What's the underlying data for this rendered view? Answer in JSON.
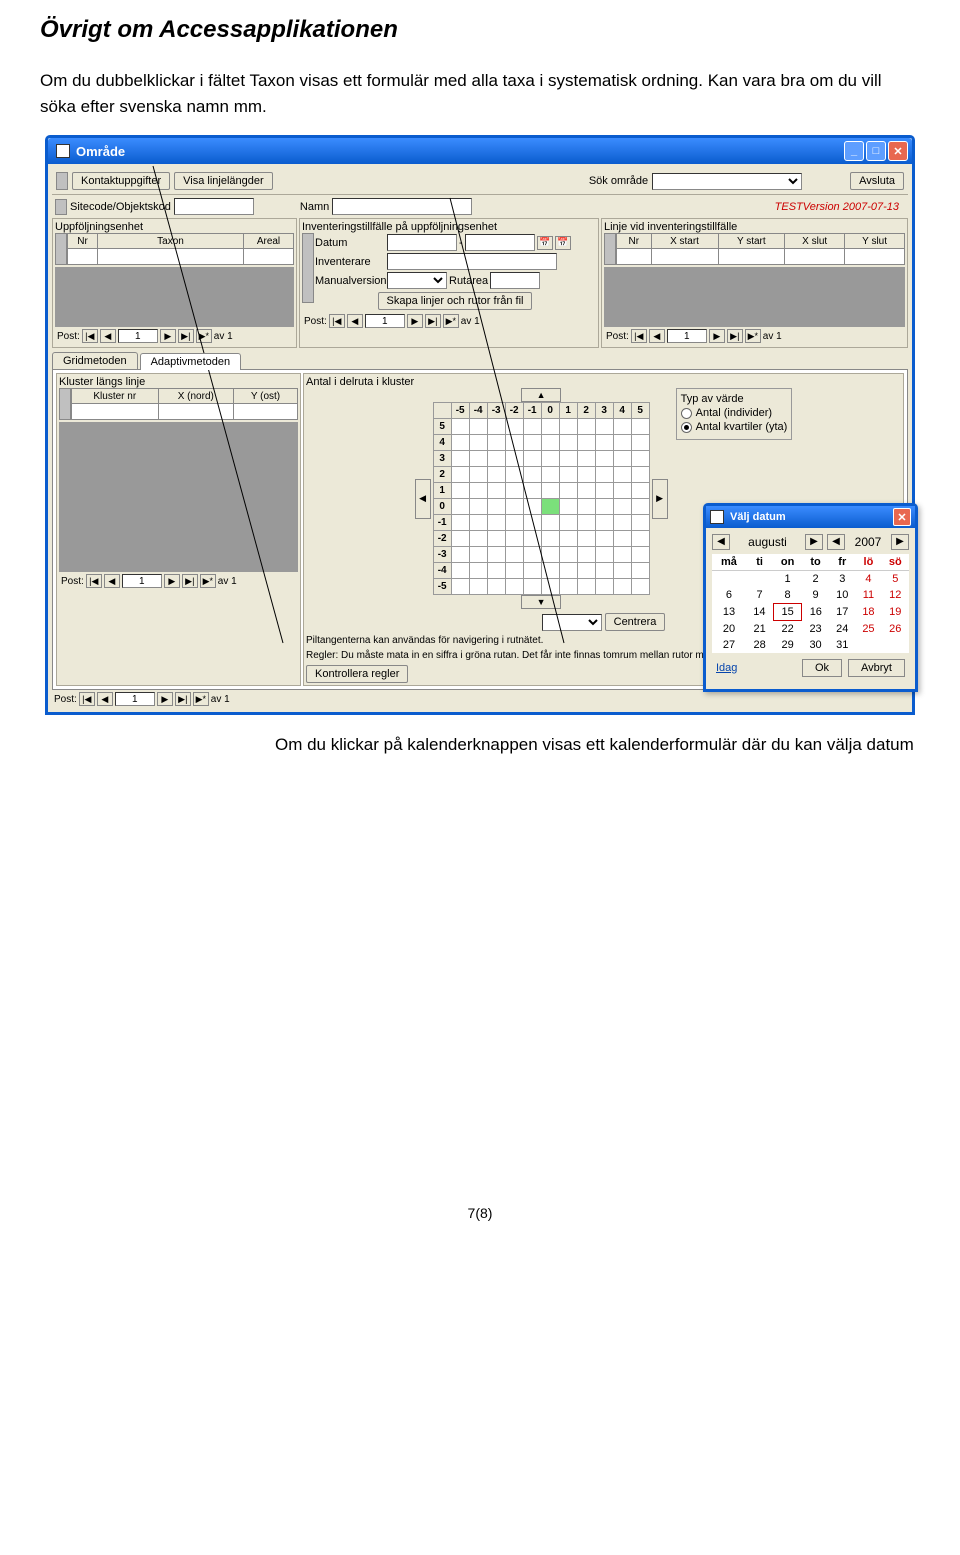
{
  "page": {
    "heading": "Övrigt om Accessapplikationen",
    "desc": "Om du dubbelklickar i fältet Taxon visas ett formulär med alla taxa i systematisk ordning. Kan vara bra om du vill söka efter svenska namn mm.",
    "footer_desc": "Om du klickar på kalenderknappen visas ett kalenderformulär där du kan välja datum",
    "page_num": "7(8)"
  },
  "main_window": {
    "title": "Område",
    "top": {
      "kontakt_btn": "Kontaktuppgifter",
      "visa_btn": "Visa linjelängder",
      "sok_label": "Sök område",
      "avsluta": "Avsluta",
      "version": "TESTVersion 2007-07-13"
    },
    "row2": {
      "sitecode_label": "Sitecode/Objektskod",
      "namn_label": "Namn"
    },
    "uppf": {
      "group": "Uppföljningsenhet",
      "cols": [
        "Nr",
        "Taxon",
        "Areal"
      ],
      "post_label": "Post:",
      "nav_of": "av 1",
      "nav_pos": "1"
    },
    "inv": {
      "group": "Inventeringstillfälle på uppföljningsenhet",
      "datum": "Datum",
      "dash": "-",
      "inventerare": "Inventerare",
      "manualversion": "Manualversion",
      "rutarea": "Rutarea",
      "skapa_btn": "Skapa linjer och rutor från fil",
      "post_label": "Post:",
      "nav_of": "av 1",
      "nav_pos": "1"
    },
    "linje": {
      "group": "Linje vid inventeringstillfälle",
      "cols": [
        "Nr",
        "X start",
        "Y start",
        "X slut",
        "Y slut"
      ],
      "post_label": "Post:",
      "nav_of": "av 1",
      "nav_pos": "1"
    },
    "tabs": {
      "grid": "Gridmetoden",
      "adaptiv": "Adaptivmetoden"
    },
    "kluster": {
      "group": "Kluster längs linje",
      "cols": [
        "Kluster nr",
        "X (nord)",
        "Y (ost)"
      ],
      "post_label": "Post:",
      "nav_of": "av 1",
      "nav_pos": "1"
    },
    "delruta": {
      "group": "Antal i delruta i kluster",
      "x_heads": [
        "-5",
        "-4",
        "-3",
        "-2",
        "-1",
        "0",
        "1",
        "2",
        "3",
        "4",
        "5"
      ],
      "y_heads": [
        "5",
        "4",
        "3",
        "2",
        "1",
        "0",
        "-1",
        "-2",
        "-3",
        "-4",
        "-5"
      ],
      "centrera": "Centrera",
      "help1": "Piltangenterna kan användas för navigering i rutnätet.",
      "help2": "Regler: Du måste mata in en siffra i gröna rutan. Det får inte finnas tomrum mellan rutor med värden.",
      "kontrollera": "Kontrollera regler"
    },
    "typ": {
      "group": "Typ av värde",
      "opt1": "Antal (individer)",
      "opt2": "Antal kvartiler (yta)"
    },
    "bottom_post": {
      "label": "Post:",
      "nav_of": "av 1",
      "nav_pos": "1"
    }
  },
  "datepicker": {
    "title": "Välj datum",
    "month": "augusti",
    "year": "2007",
    "weekdays": [
      "må",
      "ti",
      "on",
      "to",
      "fr",
      "lö",
      "sö"
    ],
    "days": [
      [
        "",
        "",
        "1",
        "2",
        "3",
        "4",
        "5"
      ],
      [
        "6",
        "7",
        "8",
        "9",
        "10",
        "11",
        "12"
      ],
      [
        "13",
        "14",
        "15",
        "16",
        "17",
        "18",
        "19"
      ],
      [
        "20",
        "21",
        "22",
        "23",
        "24",
        "25",
        "26"
      ],
      [
        "27",
        "28",
        "29",
        "30",
        "31",
        "",
        ""
      ]
    ],
    "selected": "15",
    "today": "Idag",
    "ok": "Ok",
    "cancel": "Avbryt"
  }
}
